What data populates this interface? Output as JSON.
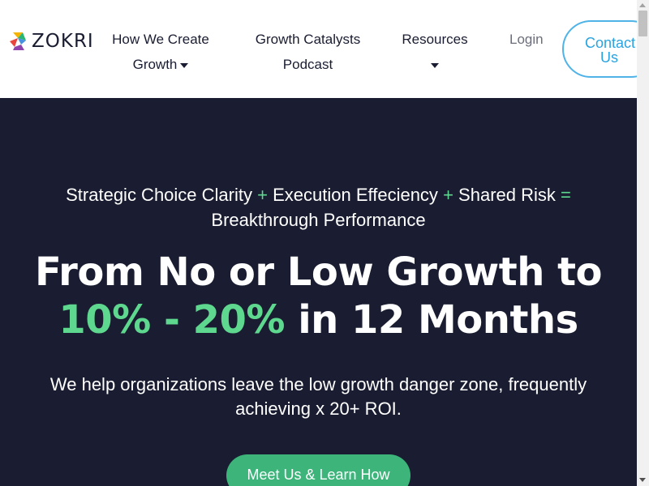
{
  "brand": {
    "name": "ZOKRI"
  },
  "nav": {
    "item1_line1": "How We Create",
    "item1_line2": "Growth",
    "item2_line1": "Growth Catalysts",
    "item2_line2": "Podcast",
    "item3": "Resources",
    "login": "Login",
    "contact_line1": "Contact",
    "contact_line2": "Us"
  },
  "hero": {
    "tagline_part1": "Strategic Choice Clarity",
    "tagline_op1": "+",
    "tagline_part2": "Execution Effeciency",
    "tagline_op2": "+",
    "tagline_part3": "Shared Risk",
    "tagline_op3": "=",
    "tagline_part4": "Breakthrough Performance",
    "headline_line1": "From No or Low Growth to",
    "headline_highlight": "10% - 20%",
    "headline_rest": " in 12 Months",
    "subtext": "We help organizations leave the low growth danger zone, frequently achieving x 20+ ROI.",
    "cta": "Meet Us & Learn How"
  },
  "colors": {
    "accent_green": "#5fd88f",
    "hero_bg": "#1a1d31",
    "contact_blue": "#2aa3e0",
    "cta_green": "#3db57a"
  }
}
